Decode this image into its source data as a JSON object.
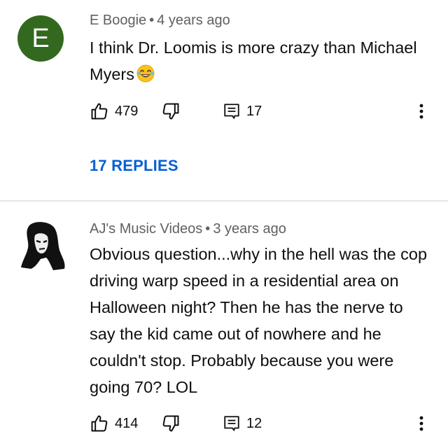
{
  "comments": [
    {
      "avatar_letter": "E",
      "author": "E Boogie",
      "separator": "•",
      "time": "4 years ago",
      "text": "I think Dr. Loomis is more crazy than Michael Myers",
      "emoji": "laughing-emoji",
      "likes": "479",
      "replies_count": "17",
      "replies_link": "17 REPLIES"
    },
    {
      "avatar": "silhouette-portrait",
      "author": "AJ's Music Videos",
      "separator": "•",
      "time": "3 years ago",
      "text": "Obvious question...why in the hell was the cop driving warp speed in a residential area on Halloween night? Then he has the nerve to say the kid came out of nowhere and he couldn't stop. Probably because you were going 70? LOL",
      "likes": "414",
      "replies_count": "12"
    }
  ],
  "colors": {
    "avatar_bg": "#33691e",
    "link": "#065fd4",
    "meta": "#606060"
  }
}
